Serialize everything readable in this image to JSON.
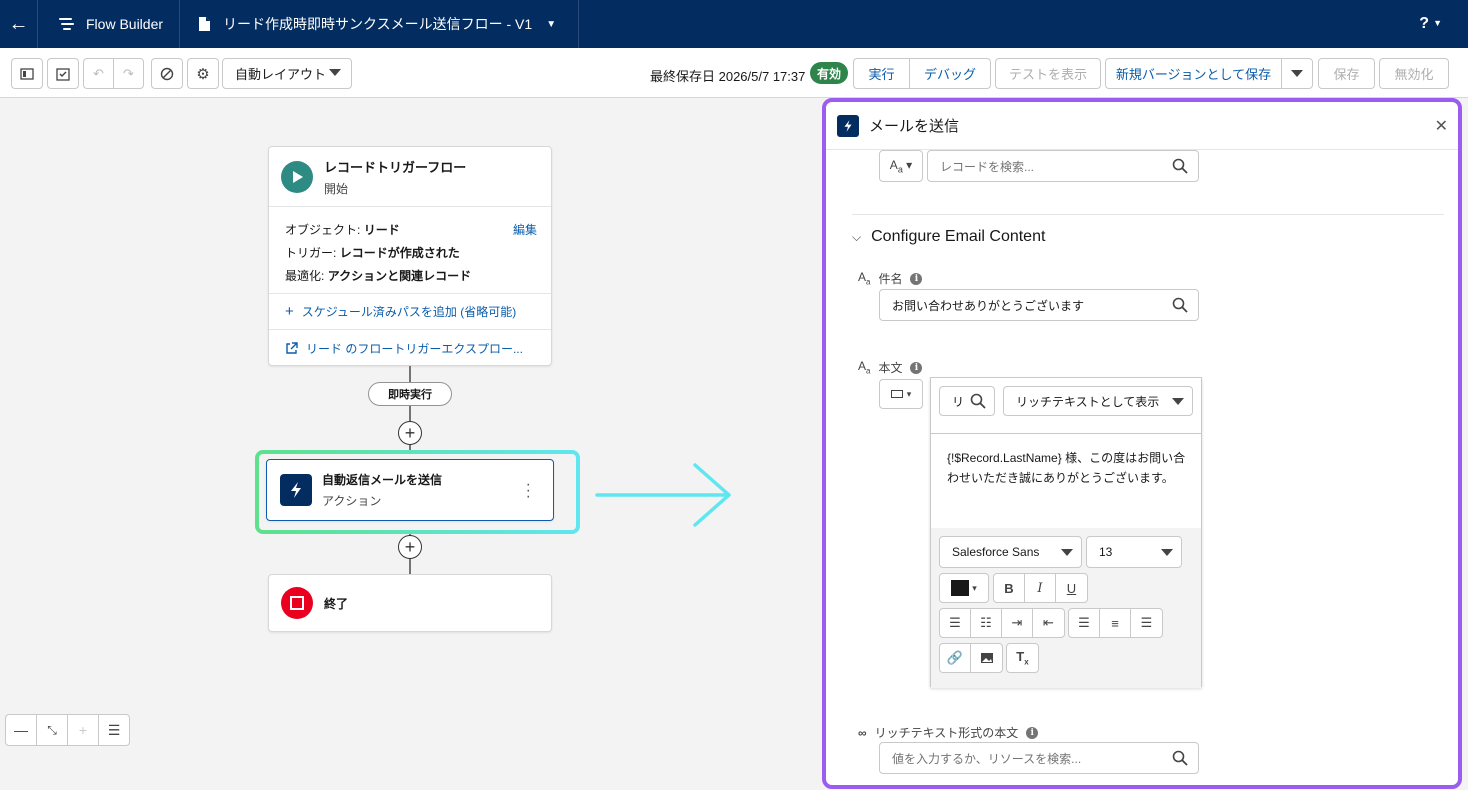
{
  "header": {
    "app_name": "Flow Builder",
    "flow_title": "リード作成時即時サンクスメール送信フロー - V1",
    "help_label": "?"
  },
  "toolbar": {
    "layout_select": "自動レイアウト",
    "saved_text": "最終保存日 2026/5/7 17:37",
    "status_badge": "有効",
    "run_label": "実行",
    "debug_label": "デバッグ",
    "view_tests_label": "テストを表示",
    "save_new_version_label": "新規バージョンとして保存",
    "save_label": "保存",
    "deactivate_label": "無効化"
  },
  "canvas": {
    "start": {
      "title": "レコードトリガーフロー",
      "subtitle": "開始",
      "object_label": "オブジェクト:",
      "object_value": "リード",
      "edit_label": "編集",
      "trigger_label": "トリガー:",
      "trigger_value": "レコードが作成された",
      "optimize_label": "最適化:",
      "optimize_value": "アクションと関連レコード",
      "add_path_label": "スケジュール済みパスを追加 (省略可能)",
      "explorer_label": "リード のフロートリガーエクスプロー..."
    },
    "path_pill": "即時実行",
    "action": {
      "title": "自動返信メールを送信",
      "subtitle": "アクション"
    },
    "end": {
      "title": "終了"
    }
  },
  "panel": {
    "title": "メールを送信",
    "record_search_placeholder": "レコードを検索...",
    "section_title": "Configure Email Content",
    "subject_label": "件名",
    "subject_value": "お問い合わせありがとうございます",
    "body_label": "本文",
    "rte_search_value": "リ",
    "rte_display_mode": "リッチテキストとして表示",
    "body_content": "{!$Record.LastName} 様、この度はお問い合わせいただき誠にありがとうございます。",
    "font_family": "Salesforce Sans",
    "font_size": "13",
    "rich_text_label": "リッチテキスト形式の本文",
    "rich_text_placeholder": "値を入力するか、リソースを検索..."
  },
  "colors": {
    "header_bg": "#032d60",
    "brand_blue": "#0b5cab",
    "active_green": "#2e844a",
    "start_teal": "#2e8b84",
    "end_red": "#ea001e",
    "panel_border": "#9b5cf0",
    "highlight_arrow": "#5fe6f0"
  }
}
